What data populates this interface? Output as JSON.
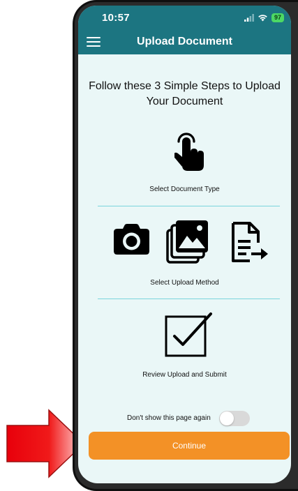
{
  "status_bar": {
    "time": "10:57",
    "battery": "97"
  },
  "header": {
    "title": "Upload Document",
    "menu_icon": "hamburger-menu-icon"
  },
  "intro": {
    "text": "Follow these 3 Simple Steps to Upload Your Document"
  },
  "steps": [
    {
      "label": "Select Document Type",
      "icon": "tap-hand-icon"
    },
    {
      "label": "Select Upload Method",
      "icons": [
        "camera-icon",
        "photo-gallery-icon",
        "file-upload-icon"
      ]
    },
    {
      "label": "Review Upload and Submit",
      "icon": "checkbox-checked-icon"
    }
  ],
  "toggle": {
    "label": "Don't show this page again",
    "checked": false
  },
  "continue_button": {
    "label": "Continue"
  },
  "colors": {
    "header_bg": "#1c7581",
    "screen_bg": "#eaf7f7",
    "divider": "#7ad4dc",
    "button_bg": "#f39126",
    "arrow": "#e8000b"
  }
}
